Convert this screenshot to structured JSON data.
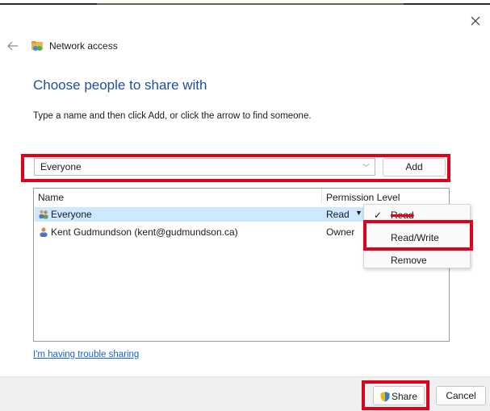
{
  "window": {
    "title": "Network access",
    "close_label": "×"
  },
  "page": {
    "heading": "Choose people to share with",
    "instructions": "Type a name and then click Add, or click the arrow to find someone.",
    "trouble_link": "I'm having trouble sharing"
  },
  "name_input": {
    "value": "Everyone",
    "add_label": "Add"
  },
  "list": {
    "headers": {
      "name": "Name",
      "permission": "Permission Level"
    },
    "rows": [
      {
        "name": "Everyone",
        "permission": "Read",
        "icon": "group-icon",
        "selected": true
      },
      {
        "name": "Kent Gudmundson (kent@gudmundson.ca)",
        "permission": "Owner",
        "icon": "user-icon",
        "selected": false
      }
    ]
  },
  "permission_menu": {
    "items": [
      {
        "label": "Read",
        "checked": true
      },
      {
        "label": "Read/Write",
        "checked": false
      },
      {
        "label": "Remove",
        "checked": false
      }
    ]
  },
  "footer": {
    "share_label": "Share",
    "cancel_label": "Cancel"
  },
  "colors": {
    "accent_heading": "#1f4e9d",
    "link": "#1a63c8",
    "selection": "#cde8ff",
    "highlight": "#e0001b"
  }
}
